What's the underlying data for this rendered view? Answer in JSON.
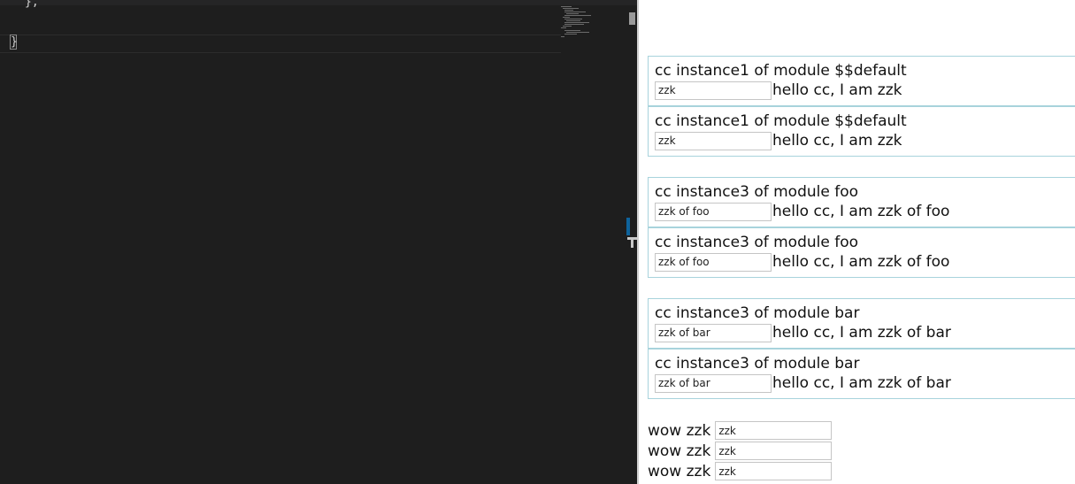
{
  "editor": {
    "line_top": "},",
    "line_brace": "}"
  },
  "groups": [
    {
      "cards": [
        {
          "title": "cc instance1 of module $$default",
          "input_value": "zzk",
          "greeting": "hello cc, I am zzk"
        },
        {
          "title": "cc instance1 of module $$default",
          "input_value": "zzk",
          "greeting": "hello cc, I am zzk"
        }
      ]
    },
    {
      "cards": [
        {
          "title": "cc instance3 of module foo",
          "input_value": "zzk of foo",
          "greeting": "hello cc, I am zzk of foo"
        },
        {
          "title": "cc instance3 of module foo",
          "input_value": "zzk of foo",
          "greeting": "hello cc, I am zzk of foo"
        }
      ]
    },
    {
      "cards": [
        {
          "title": "cc instance3 of module bar",
          "input_value": "zzk of bar",
          "greeting": "hello cc, I am zzk of bar"
        },
        {
          "title": "cc instance3 of module bar",
          "input_value": "zzk of bar",
          "greeting": "hello cc, I am zzk of bar"
        }
      ]
    }
  ],
  "wow_rows": [
    {
      "label": "wow zzk",
      "input_value": "zzk"
    },
    {
      "label": "wow zzk",
      "input_value": "zzk"
    },
    {
      "label": "wow zzk",
      "input_value": "zzk"
    }
  ]
}
